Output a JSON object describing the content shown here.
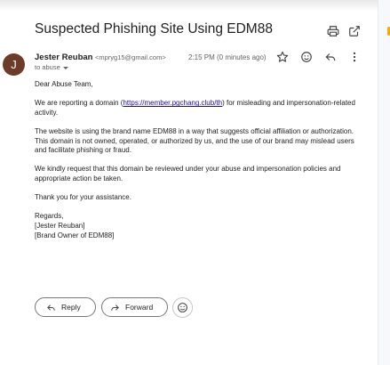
{
  "email": {
    "subject": "Suspected Phishing Site Using EDM88",
    "sender_name": "Jester Reuban",
    "sender_email": "<mpryg15@gmail.com>",
    "avatar_initial": "J",
    "avatar_color": "#6d3b2a",
    "time": "2:15 PM (0 minutes ago)",
    "to": "to abuse",
    "greeting": "Dear Abuse Team,",
    "p1_before": "We are reporting a domain (",
    "p1_link": "https://member.pgchang.club/th",
    "p1_after": ") for misleading and impersonation-related activity.",
    "p2": "The website is using the brand name EDM88 in a way that suggests official affiliation or authorization. This domain is not owned, operated, or authorized by us, and the use of our brand may mislead users and facilitate phishing or fraud.",
    "p3": "We kindly request that this domain be reviewed under your abuse and impersonation policies and appropriate action be taken.",
    "p4": "Thank you for your assistance.",
    "sign_1": "Regards,",
    "sign_2": "[Jester Reuban]",
    "sign_3": "[Brand Owner of EDM88]"
  },
  "actions": {
    "reply_label": "Reply",
    "forward_label": "Forward"
  },
  "icons": [
    "print-icon",
    "open-in-new-icon",
    "star-icon",
    "emoji-icon",
    "reply-icon",
    "more-vert-icon",
    "forward-icon"
  ],
  "colors": {
    "link": "#1a0dab",
    "text": "#202124",
    "muted": "#5f6368"
  }
}
